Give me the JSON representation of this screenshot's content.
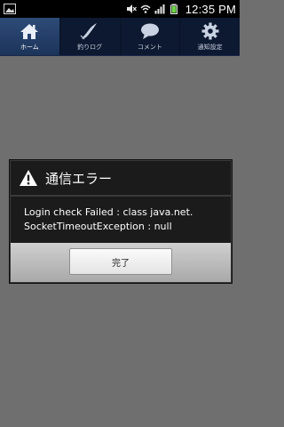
{
  "statusbar": {
    "time": "12:35 PM",
    "icons": [
      "image-notification-icon",
      "mute-icon",
      "wifi-icon",
      "signal-icon",
      "battery-icon"
    ]
  },
  "tabs": [
    {
      "label": "ホーム",
      "icon": "house-icon",
      "active": true
    },
    {
      "label": "釣りログ",
      "icon": "fish-icon",
      "active": false
    },
    {
      "label": "コメント",
      "icon": "chat-bubble-icon",
      "active": false
    },
    {
      "label": "通知設定",
      "icon": "gear-icon",
      "active": false
    }
  ],
  "dialog": {
    "title": "通信エラー",
    "message": "Login check Failed : class java.net.\nSocketTimeoutException : null",
    "button_label": "完了"
  },
  "colors": {
    "tabbar_bg": "#0d1930",
    "tab_active_bg": "#2d4b78",
    "overlay_bg": "#6f6f6f",
    "dialog_bg": "#1b1b1b",
    "dialog_footer_bg": "#c2c2c2"
  }
}
